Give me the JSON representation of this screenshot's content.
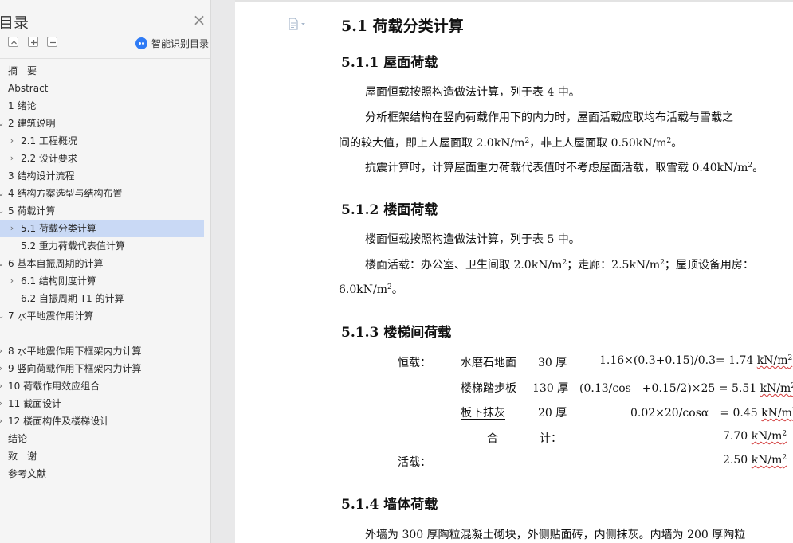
{
  "sidebar": {
    "title": "目录",
    "smart_label": "智能识别目录",
    "items": [
      {
        "label": "摘　要",
        "chev": ""
      },
      {
        "label": "Abstract",
        "chev": ""
      },
      {
        "label": "1 绪论",
        "chev": ""
      },
      {
        "label": "2 建筑说明",
        "chev": "⌄"
      },
      {
        "label": "2.1 工程概况",
        "chev": "›"
      },
      {
        "label": "2.2 设计要求",
        "chev": "›"
      },
      {
        "label": "3 结构设计流程",
        "chev": ""
      },
      {
        "label": "4 结构方案选型与结构布置",
        "chev": "⌄"
      },
      {
        "label": "5 荷载计算",
        "chev": "⌄"
      },
      {
        "label": "5.1 荷载分类计算",
        "chev": "›"
      },
      {
        "label": "5.2 重力荷载代表值计算",
        "chev": ""
      },
      {
        "label": "6 基本自振周期的计算",
        "chev": "⌄"
      },
      {
        "label": "6.1 结构刚度计算",
        "chev": "›"
      },
      {
        "label": "6.2 自振周期 T1 的计算",
        "chev": ""
      },
      {
        "label": "7 水平地震作用计算",
        "chev": "⌄"
      },
      {
        "label": "8 水平地震作用下框架内力计算",
        "chev": "›"
      },
      {
        "label": "9 竖向荷载作用下框架内力计算",
        "chev": "›"
      },
      {
        "label": "10 荷载作用效应组合",
        "chev": "›"
      },
      {
        "label": "11 截面设计",
        "chev": "›"
      },
      {
        "label": "12 楼面构件及楼梯设计",
        "chev": "›"
      },
      {
        "label": "结论",
        "chev": ""
      },
      {
        "label": "致　谢",
        "chev": ""
      },
      {
        "label": "参考文献",
        "chev": ""
      }
    ]
  },
  "doc": {
    "h_51": "5.1 荷载分类计算",
    "h_511": "5.1.1 屋面荷载",
    "p1": "屋面恒载按照构造做法计算，列于表 4 中。",
    "p2a": "分析框架结构在竖向荷载作用下的内力时，屋面活载应取均布活载与雪载之",
    "p2b_1": "间的较大值，即上人屋面取 2.0kN/m",
    "p2b_2": "，非上人屋面取 0.50kN/m",
    "p2b_3": "。",
    "p3_1": "抗震计算时，计算屋面重力荷载代表值时不考虑屋面活载，取雪载 0.40kN/m",
    "p3_2": "。",
    "h_512": "5.1.2 楼面荷载",
    "p4": "楼面恒载按照构造做法计算，列于表 5 中。",
    "p5_1": "楼面活载：办公室、卫生间取 2.0kN/m",
    "p5_2": "；走廊：2.5kN/m",
    "p5_3": "；屋顶设备用房：",
    "p6_1": "6.0kN/m",
    "p6_2": "。",
    "h_513": "5.1.3 楼梯间荷载",
    "stair": {
      "dead_label": "恒载：",
      "r1_name": "水磨石地面",
      "r1_thk": "30 厚",
      "r1_expr": "1.16×(0.3+0.15)/0.3= 1.74",
      "r2_name": "楼梯踏步板",
      "r2_thk": "130 厚",
      "r2_expr": "(0.13/cos　+0.15/2)×25 = 5.51",
      "r3_name": "板下抹灰",
      "r3_thk": "20 厚",
      "r3_expr": "0.02×20/cosα　= 0.45",
      "sum_a": "合",
      "sum_b": "计：",
      "sum_val": "7.70",
      "live_label": "活载：",
      "live_val": "2.50",
      "unit": "kN/m",
      "sup": "2"
    },
    "h_514": "5.1.4 墙体荷载",
    "p7": "外墙为 300 厚陶粒混凝土砌块，外侧贴面砖，内侧抹灰。内墙为 200 厚陶粒"
  }
}
